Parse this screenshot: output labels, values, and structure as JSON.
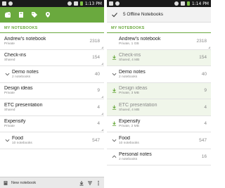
{
  "left": {
    "status": {
      "time": "1:13 PM"
    },
    "section_title": "MY NOTEBOOKS",
    "notebooks": [
      {
        "name": "Andrew's notebook",
        "sub": "Private",
        "count": "2318",
        "stack": false
      },
      {
        "name": "Check-ins",
        "sub": "Shared",
        "count": "154",
        "stack": false
      },
      {
        "name": "Demo notes",
        "sub": "2 notebooks",
        "count": "40",
        "stack": true
      },
      {
        "name": "Design ideas",
        "sub": "Private",
        "count": "9",
        "stack": false
      },
      {
        "name": "ETC presentation",
        "sub": "Shared",
        "count": "4",
        "stack": false
      },
      {
        "name": "Expensify",
        "sub": "Private",
        "count": "4",
        "stack": false
      },
      {
        "name": "Food",
        "sub": "10 notebooks",
        "count": "547",
        "stack": true
      }
    ],
    "bottom": {
      "new_notebook_label": "New notebook"
    }
  },
  "right": {
    "status": {
      "time": "1:14 PM"
    },
    "header_title": "5 Offline Notebooks",
    "section_title": "MY NOTEBOOKS",
    "notebooks": [
      {
        "name": "Andrew's notebook",
        "sub": "Private, 1 GB",
        "count": "2318",
        "state": "plain"
      },
      {
        "name": "Check-ins",
        "sub": "Shared, 4 MB",
        "count": "154",
        "state": "downloaded"
      },
      {
        "name": "Demo notes",
        "sub": "2 notebooks",
        "count": "40",
        "state": "stack"
      },
      {
        "name": "Design ideas",
        "sub": "Private, 3 MB",
        "count": "9",
        "state": "downloaded"
      },
      {
        "name": "ETC presentation",
        "sub": "Shared, 4 MB",
        "count": "4",
        "state": "downloaded"
      },
      {
        "name": "Expensify",
        "sub": "Private, 2 MB",
        "count": "4",
        "state": "downloaded-plain"
      },
      {
        "name": "Food",
        "sub": "10 notebooks",
        "count": "547",
        "state": "stack"
      },
      {
        "name": "Personal notes",
        "sub": "2 notebooks",
        "count": "16",
        "state": "stack"
      }
    ]
  },
  "colors": {
    "accent": "#6aa93e",
    "downloaded_bg": "#f0f6ea"
  }
}
